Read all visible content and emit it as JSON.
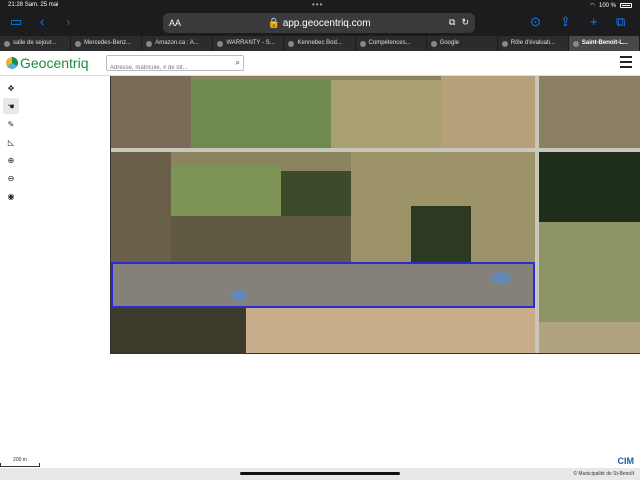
{
  "status": {
    "time": "21:28",
    "date": "Sam. 25 mai",
    "battery": "100 %"
  },
  "browser": {
    "aa_label": "AA",
    "url": "app.geocentriq.com",
    "tabs": [
      {
        "label": "salle de sejour..."
      },
      {
        "label": "Mercedes-Benz..."
      },
      {
        "label": "Amazon.ca : A..."
      },
      {
        "label": "WARRANTY - S..."
      },
      {
        "label": "Kennebec Bod..."
      },
      {
        "label": "Compétences..."
      },
      {
        "label": "Google"
      },
      {
        "label": "Rôle d'évaluati..."
      },
      {
        "label": "Saint-Benoît-L..."
      }
    ]
  },
  "app": {
    "logo_text": "Geocentriq",
    "search_placeholder": "Adresse, matricule, # de lot...",
    "scale_label": "200 m",
    "brand": "CIM",
    "copyright": "© Municipalité de St-Benoît"
  },
  "colors": {
    "accent": "#0a84ff",
    "selection": "#2a2ad6",
    "logo": "#1b8a3e"
  }
}
